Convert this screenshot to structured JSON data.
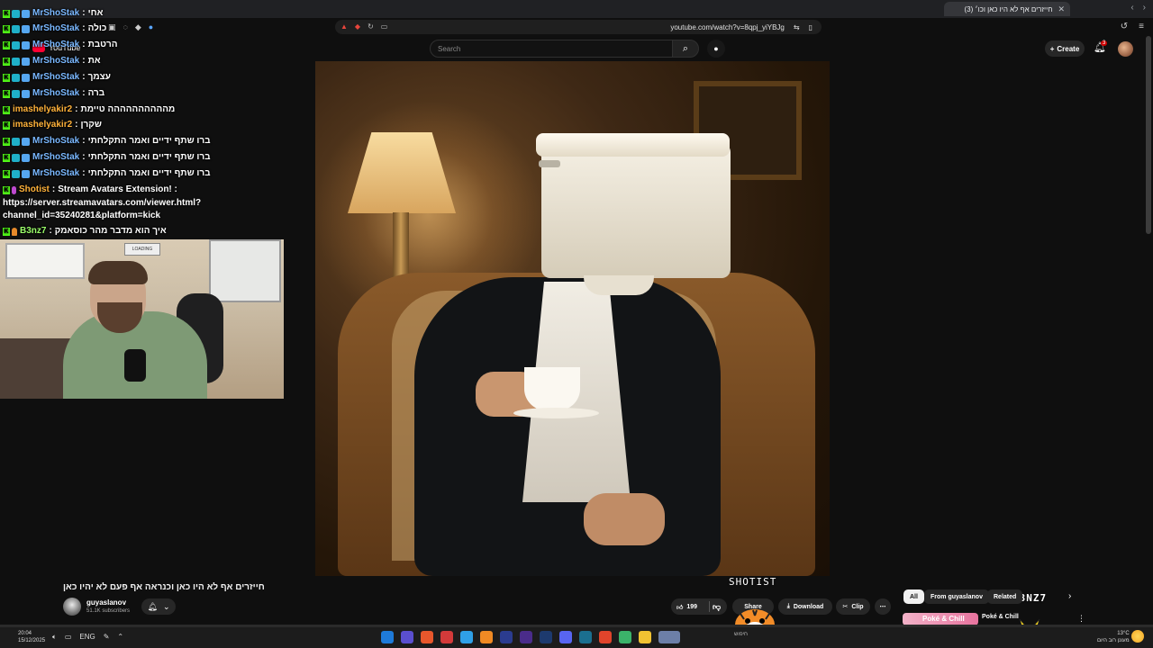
{
  "browser": {
    "tab_title": "(3) חייזרים אף לא היו כאן וכו׳",
    "url": "youtube.com/watch?v=8qpj_yiYBJg"
  },
  "youtube": {
    "logo_text": "YouTube",
    "search_placeholder": "Search",
    "create_label": "Create",
    "notification_count": "3"
  },
  "chat": {
    "messages": [
      {
        "user": "MrShoStak",
        "text": "אחי",
        "user_color": "blue"
      },
      {
        "user": "MrShoStak",
        "text": "כולה",
        "user_color": "blue"
      },
      {
        "user": "MrShoStak",
        "text": "הרטבת",
        "user_color": "blue"
      },
      {
        "user": "MrShoStak",
        "text": "את",
        "user_color": "blue"
      },
      {
        "user": "MrShoStak",
        "text": "עצמך",
        "user_color": "blue"
      },
      {
        "user": "MrShoStak",
        "text": "ברה",
        "user_color": "blue"
      },
      {
        "user": "imashelyakir2",
        "text": "מהההההההההה טיימת",
        "user_color": "orange"
      },
      {
        "user": "imashelyakir2",
        "text": "שקרן",
        "user_color": "orange"
      },
      {
        "user": "MrShoStak",
        "text": "ברו שתף ידיים ואמר התקלחתי",
        "user_color": "blue"
      },
      {
        "user": "MrShoStak",
        "text": "ברו שתף ידיים ואמר התקלחתי",
        "user_color": "blue"
      },
      {
        "user": "MrShoStak",
        "text": "ברו שתף ידיים ואמר התקלחתי",
        "user_color": "blue"
      },
      {
        "user": "Shotist",
        "text": "Stream Avatars Extension! :",
        "user_color": "orange"
      },
      {
        "user": "B3nz7",
        "text": "איך הוא מדבר מהר כוסאמק",
        "user_color": "green"
      }
    ],
    "wrap_line_1": "https://server.streamavatars.com/viewer.html?",
    "wrap_line_2": "channel_id=35240281&platform=kick"
  },
  "webcam": {
    "tv_text": "LOADING"
  },
  "video": {
    "title": "חייזרים אף לא היו כאן וכנראה אף פעם לא יהיו כאן",
    "channel_name": "guyaslanov",
    "subscribers": "51.1K subscribers",
    "likes": "199",
    "share_label": "Share",
    "download_label": "Download",
    "clip_label": "Clip"
  },
  "overlays": {
    "avatar_name_1": "SHOTIST",
    "avatar_name_2": "B3NZ7"
  },
  "recommendations": {
    "chips": [
      "All",
      "From guyaslanov",
      "Related"
    ],
    "first_title": "Poké & Chill",
    "thumb_text": "Poké & Chill"
  },
  "taskbar": {
    "time": "20:04",
    "date": "15/12/2025",
    "lang": "ENG",
    "search_text": "חיפוש",
    "weather_temp": "13°C",
    "weather_desc": "מעונן רוב היום"
  },
  "colors": {
    "youtube_red": "#ff0033",
    "kick_green": "#53fc18",
    "chat_blue": "#7ab8ff",
    "chat_orange": "#ffb23a"
  }
}
